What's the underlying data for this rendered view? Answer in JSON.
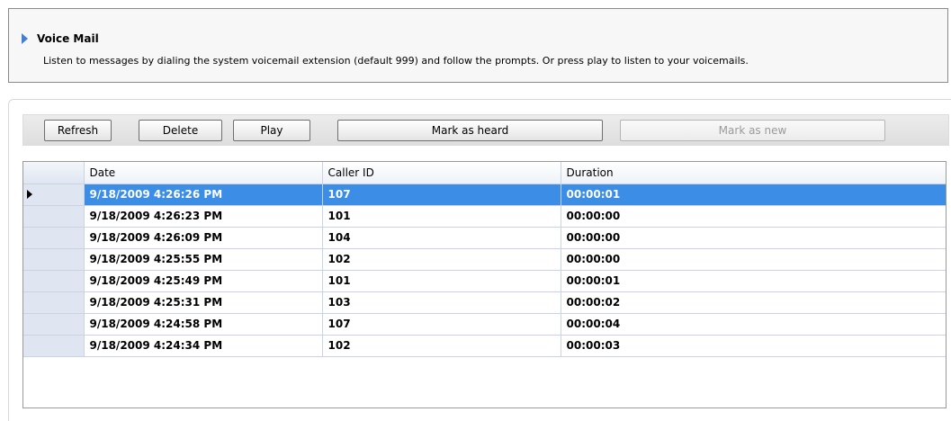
{
  "header": {
    "title": "Voice Mail",
    "description": "Listen to messages by dialing the system voicemail extension (default 999) and follow the prompts. Or press play to listen to your voicemails."
  },
  "toolbar": {
    "refresh_label": "Refresh",
    "delete_label": "Delete",
    "play_label": "Play",
    "mark_heard_label": "Mark as heard",
    "mark_new_label": "Mark as new"
  },
  "grid": {
    "columns": [
      "Date",
      "Caller ID",
      "Duration"
    ],
    "selected_row": 0,
    "rows": [
      {
        "date": "9/18/2009 4:26:26 PM",
        "caller_id": "107",
        "duration": "00:00:01"
      },
      {
        "date": "9/18/2009 4:26:23 PM",
        "caller_id": "101",
        "duration": "00:00:00"
      },
      {
        "date": "9/18/2009 4:26:09 PM",
        "caller_id": "104",
        "duration": "00:00:00"
      },
      {
        "date": "9/18/2009 4:25:55 PM",
        "caller_id": "102",
        "duration": "00:00:00"
      },
      {
        "date": "9/18/2009 4:25:49 PM",
        "caller_id": "101",
        "duration": "00:00:01"
      },
      {
        "date": "9/18/2009 4:25:31 PM",
        "caller_id": "103",
        "duration": "00:00:02"
      },
      {
        "date": "9/18/2009 4:24:58 PM",
        "caller_id": "107",
        "duration": "00:00:04"
      },
      {
        "date": "9/18/2009 4:24:34 PM",
        "caller_id": "102",
        "duration": "00:00:03"
      }
    ]
  },
  "colors": {
    "accent": "#3f7fd6",
    "selection": "#3b8de6"
  }
}
